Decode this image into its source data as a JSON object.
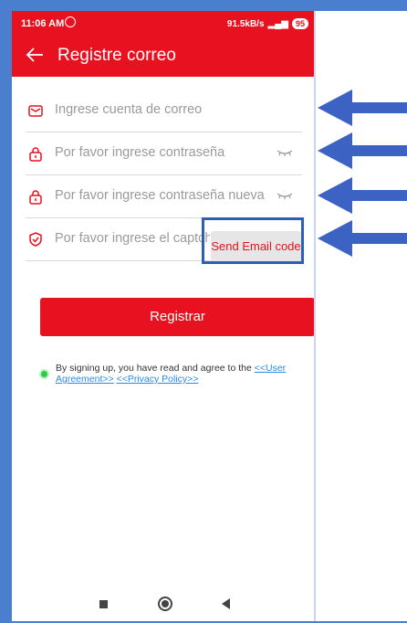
{
  "status_bar": {
    "time": "11:06 AM",
    "network_speed": "91.5kB/s",
    "battery": "95"
  },
  "header": {
    "title": "Registre correo",
    "back_icon": "arrow-left-icon"
  },
  "form": {
    "email_placeholder": "Ingrese cuenta de correo",
    "password_placeholder": "Por favor ingrese contraseña",
    "new_password_placeholder": "Por favor ingrese contraseña nueva",
    "captcha_placeholder": "Por favor ingrese el captcha",
    "send_code_label": "Send Email code",
    "register_label": "Registrar"
  },
  "agreement": {
    "text": "By signing up, you have read and agree to the ",
    "user_agreement": "<<User Agreement>>",
    "privacy_policy": "<<Privacy Policy>>"
  },
  "colors": {
    "accent": "#e8111f",
    "annotation": "#2f5fb3"
  }
}
